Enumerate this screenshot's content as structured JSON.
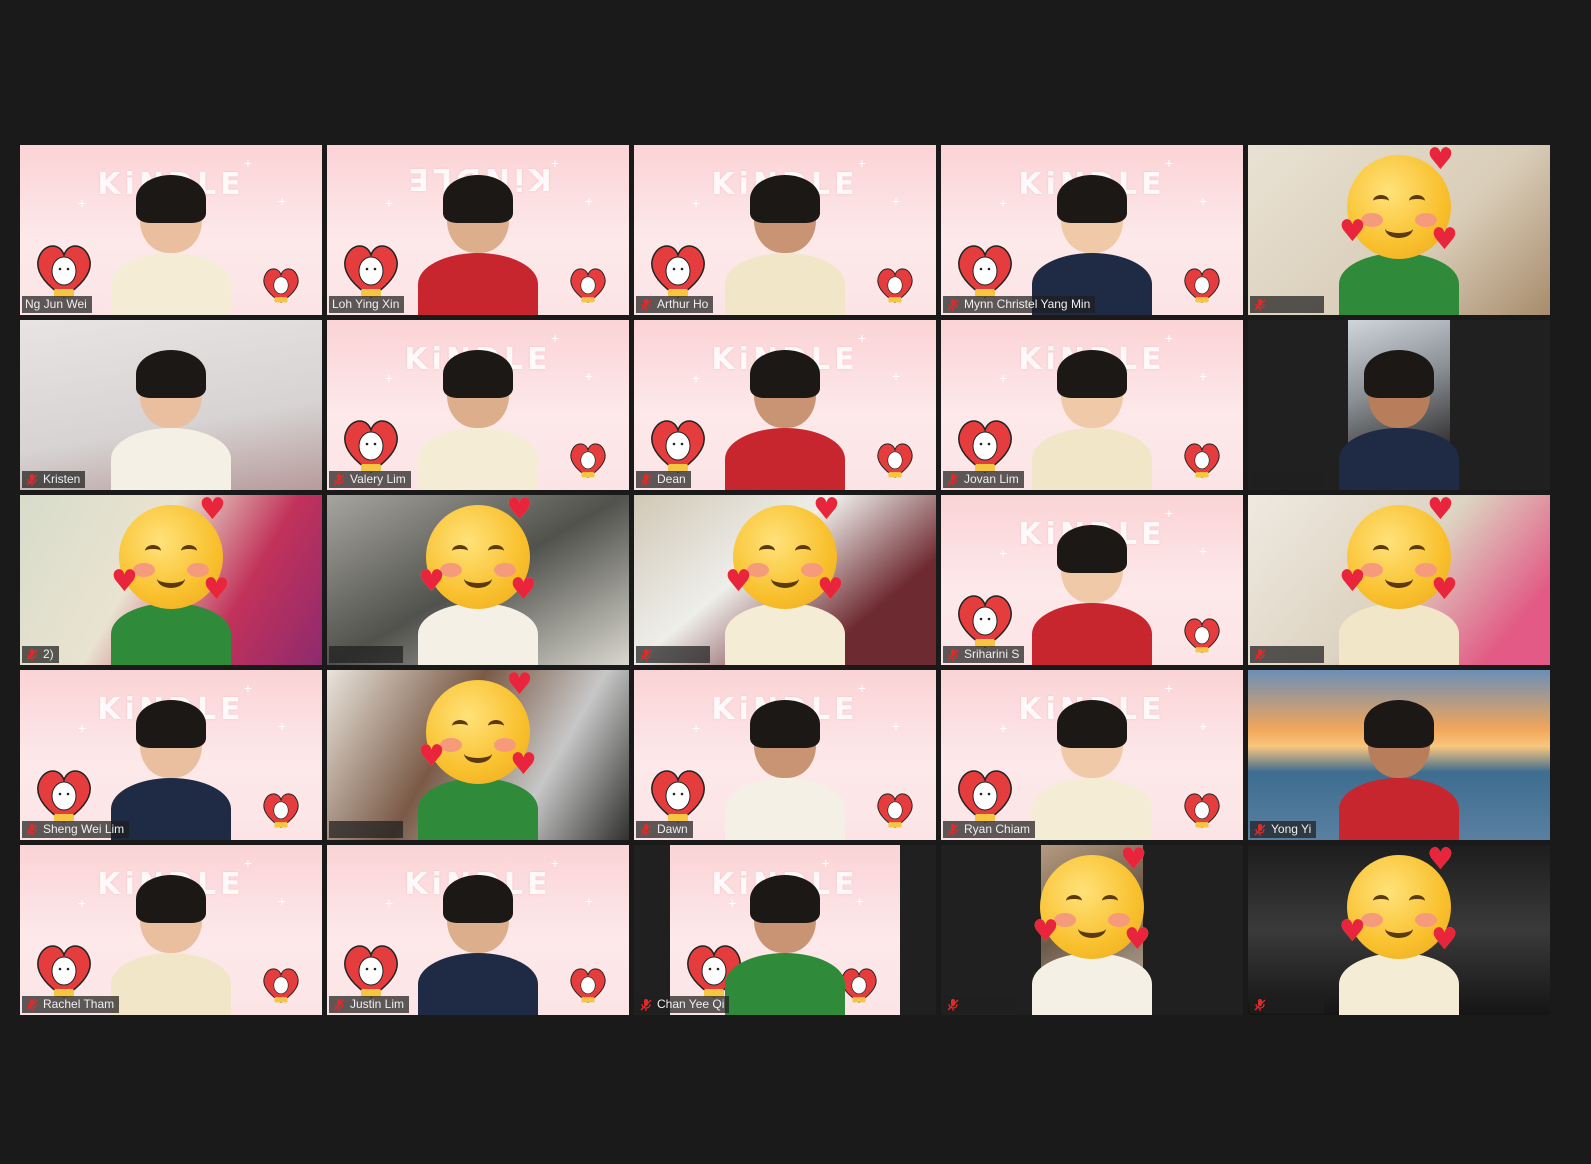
{
  "gallery": {
    "tiles": [
      {
        "name": "Ng Jun Wei",
        "muted": false,
        "active": true,
        "background": "kindle"
      },
      {
        "name": "Loh Ying Xin",
        "muted": false,
        "background": "kindle-flipped"
      },
      {
        "name": "Arthur Ho",
        "muted": true,
        "background": "kindle"
      },
      {
        "name": "Mynn Christel Yang Min",
        "muted": true,
        "background": "kindle"
      },
      {
        "name": "",
        "muted": true,
        "background": "room",
        "emoji": "smiling-face-with-hearts"
      },
      {
        "name": "Kristen",
        "muted": true,
        "background": "room"
      },
      {
        "name": "Valery Lim",
        "muted": true,
        "background": "kindle"
      },
      {
        "name": "Dean",
        "muted": true,
        "background": "kindle"
      },
      {
        "name": "Jovan Lim",
        "muted": true,
        "background": "kindle"
      },
      {
        "name": "",
        "muted": false,
        "background": "room-narrow"
      },
      {
        "name": "2)",
        "muted": true,
        "background": "room",
        "emoji": "smiling-face-with-hearts"
      },
      {
        "name": "",
        "muted": false,
        "background": "room",
        "emoji": "smiling-face-with-hearts"
      },
      {
        "name": "",
        "muted": true,
        "background": "room",
        "emoji": "smiling-face-with-hearts"
      },
      {
        "name": "Sriharini S",
        "muted": true,
        "background": "kindle"
      },
      {
        "name": "",
        "muted": true,
        "background": "room",
        "emoji": "smiling-face-with-hearts"
      },
      {
        "name": "Sheng Wei Lim",
        "muted": true,
        "background": "kindle"
      },
      {
        "name": "",
        "muted": false,
        "background": "room",
        "emoji": "smiling-face-with-hearts"
      },
      {
        "name": "Dawn",
        "muted": true,
        "background": "kindle"
      },
      {
        "name": "Ryan Chiam",
        "muted": true,
        "background": "kindle"
      },
      {
        "name": "Yong Yi",
        "muted": true,
        "background": "bridge"
      },
      {
        "name": "Rachel Tham",
        "muted": true,
        "background": "kindle"
      },
      {
        "name": "Justin Lim",
        "muted": true,
        "background": "kindle"
      },
      {
        "name": "Chan Yee Qi",
        "muted": true,
        "background": "kindle-narrow"
      },
      {
        "name": "",
        "muted": true,
        "background": "room-narrow",
        "emoji": "smiling-face-with-hearts"
      },
      {
        "name": "",
        "muted": true,
        "background": "knives",
        "emoji": "smiling-face-with-hearts"
      }
    ],
    "kindle_text": "KiNDLE",
    "kindle_text_flipped": "KiNDLE"
  },
  "colors": {
    "window_background": "#1a1a1a",
    "active_speaker_border": "#b9e04a",
    "mute_icon": "#e02b2b",
    "namebar_text": "#f0f0f0"
  }
}
